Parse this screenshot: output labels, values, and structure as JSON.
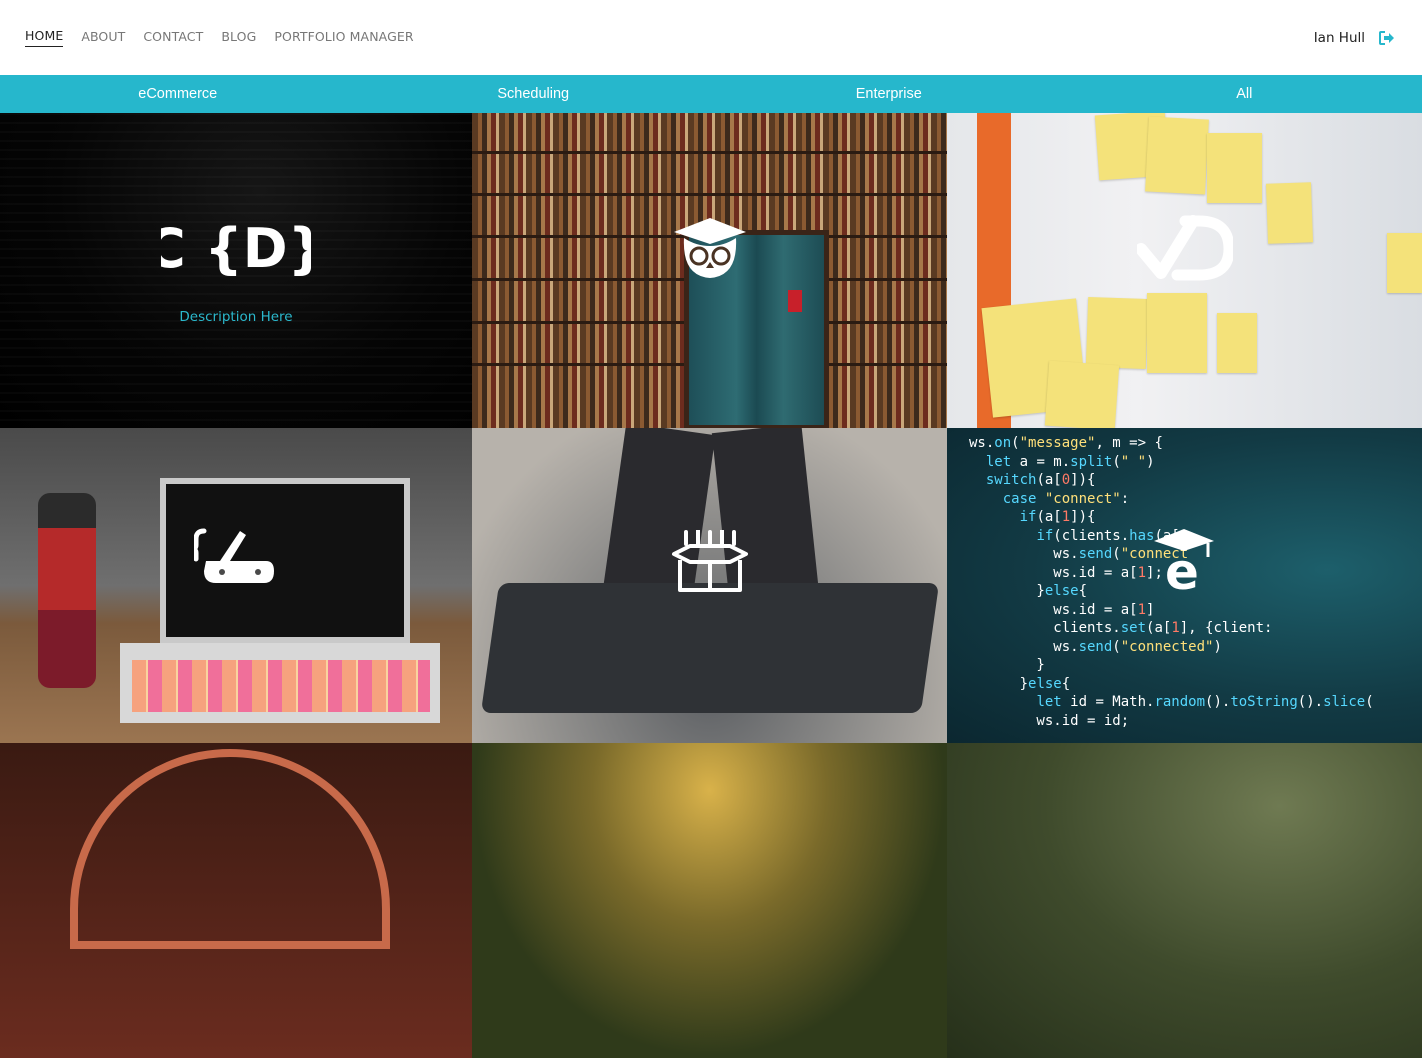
{
  "nav": {
    "links": [
      "HOME",
      "ABOUT",
      "CONTACT",
      "BLOG",
      "PORTFOLIO MANAGER"
    ],
    "active": "HOME",
    "user_name": "Ian Hull",
    "logout_icon": "sign-out-icon"
  },
  "categories": [
    "eCommerce",
    "Scheduling",
    "Enterprise",
    "All"
  ],
  "colors": {
    "accent": "#26b7cc",
    "text_dark": "#222222",
    "nav_muted": "#777777"
  },
  "portfolio": {
    "items": [
      {
        "logo_text": "C {D}",
        "logo_icon": "code-logo",
        "description": "Description Here"
      },
      {
        "logo_icon": "owl-graduation-cap-icon"
      },
      {
        "logo_icon": "checkmark-d-icon"
      },
      {
        "logo_icon": "multi-tool-knife-icon"
      },
      {
        "logo_icon": "open-box-icon"
      },
      {
        "logo_icon": "e-graduation-cap-icon"
      },
      {
        "logo_icon": "none"
      },
      {
        "logo_icon": "none"
      },
      {
        "logo_icon": "none"
      }
    ]
  },
  "code_snippet": [
    "ws.on(\"message\", m => {",
    "  let a = m.split(\" \")",
    "  switch(a[0]){",
    "    case \"connect\":",
    "      if(a[1]){",
    "        if(clients.has(a[1",
    "          ws.send(\"connect",
    "          ws.id = a[1];",
    "        }else{",
    "          ws.id = a[1]",
    "          clients.set(a[1], {client:",
    "          ws.send(\"connected\")",
    "        }",
    "      }else{",
    "        let id = Math.random().toString().slice(",
    "        ws.id = id;"
  ]
}
